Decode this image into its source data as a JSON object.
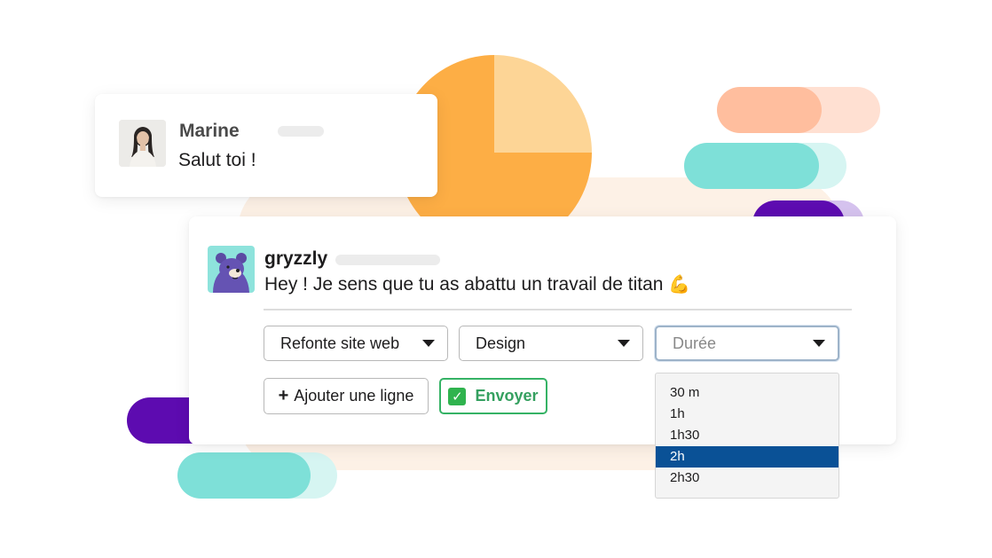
{
  "colors": {
    "accent_orange": "#fdae45",
    "accent_peach": "#fdd596",
    "teal": "#7ee0d8",
    "purple": "#5d0bb0",
    "salmon": "#ffbe9e",
    "send_green": "#35b265",
    "selection_blue": "#0a5196"
  },
  "marine_message": {
    "author": "Marine",
    "text": "Salut toi !",
    "avatar_icon": "user-photo"
  },
  "bot_message": {
    "author": "gryzzly",
    "text": "Hey ! Je sens que tu as abattu un travail de titan",
    "emoji": "💪",
    "avatar_icon": "bear-mascot"
  },
  "form": {
    "project_select": "Refonte site web",
    "task_select": "Design",
    "duration_placeholder": "Durée",
    "add_line_label": "Ajouter une ligne",
    "send_label": "Envoyer",
    "duration_options": [
      "30 m",
      "1h",
      "1h30",
      "2h",
      "2h30"
    ],
    "duration_selected": "2h"
  }
}
